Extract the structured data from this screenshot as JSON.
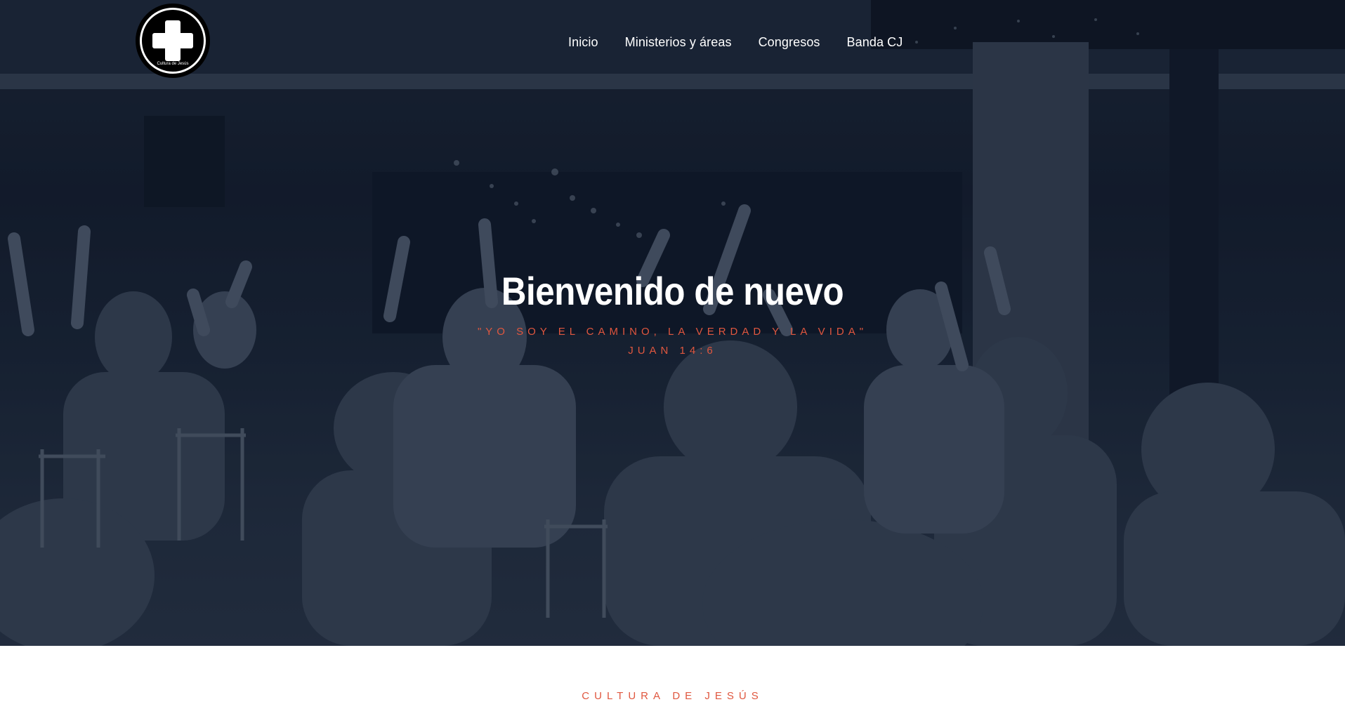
{
  "header": {
    "logo_text": "Cultura de Jesús",
    "nav": [
      {
        "label": "Inicio"
      },
      {
        "label": "Ministerios y áreas"
      },
      {
        "label": "Congresos"
      },
      {
        "label": "Banda CJ"
      }
    ]
  },
  "hero": {
    "title": "Bienvenido de nuevo",
    "quote": "\"YO SOY EL CAMINO, LA VERDAD Y LA VIDA\"",
    "reference": "JUAN 14:6"
  },
  "section": {
    "heading": "CULTURA DE JESÚS"
  },
  "colors": {
    "accent": "#e0573f",
    "hero_bg": "#1b2638",
    "nav_text": "#ffffff"
  }
}
